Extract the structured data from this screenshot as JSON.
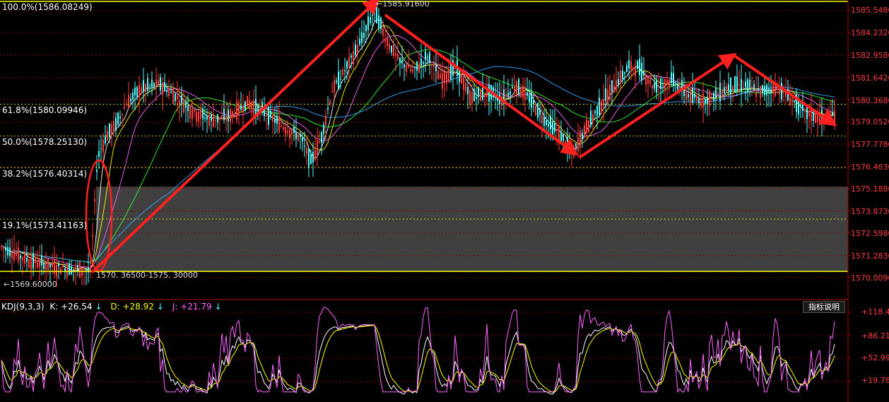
{
  "colors": {
    "background": "#000000",
    "up_candle": "#ff3b3b",
    "down_candle": "#54ffff",
    "axis": "#b00000",
    "fib_line": "#ffff00",
    "annotation": "#ff2020",
    "zone_fill": "#555555",
    "k_line": "#ffffff",
    "d_line": "#ffff00",
    "j_line": "#ff66ff"
  },
  "chart_data": [
    {
      "type": "candlestick",
      "title": "",
      "y_axis_ticks": [
        "1585.5480",
        "1584.2320",
        "1582.9580",
        "1581.6420",
        "1580.3680",
        "1579.0520",
        "1577.7780",
        "1576.4630",
        "1575.1880",
        "1573.8730",
        "1572.5980",
        "1571.2830",
        "1570.0090"
      ],
      "ylim": [
        1569.5,
        1586.4
      ],
      "fibonacci_levels": [
        {
          "label": "100.0%(1586.08249)",
          "value": 1586.08249
        },
        {
          "label": "61.8%(1580.09946)",
          "value": 1580.09946
        },
        {
          "label": "50.0%(1578.25130)",
          "value": 1578.2513
        },
        {
          "label": "38.2%(1576.40314)",
          "value": 1576.40314
        },
        {
          "label": "19.1%(1573.41163)",
          "value": 1573.41163
        }
      ],
      "zero_level": 1570.365,
      "annotations": {
        "high": {
          "label": "1585.91600",
          "value": 1585.916
        },
        "low": {
          "label": "1569.60000",
          "value": 1569.6
        },
        "range": {
          "label": "1570. 36500-1575. 30000",
          "from": 1570.365,
          "to": 1575.3
        }
      },
      "highlight_zone": [
        1570.365,
        1575.3
      ],
      "trend_arrows": [
        {
          "from": [
            130,
            1570.3
          ],
          "to": [
            532,
            1586.1
          ]
        },
        {
          "from": [
            545,
            1585.3
          ],
          "to": [
            812,
            1577.3
          ]
        },
        {
          "from": [
            820,
            1577.0
          ],
          "to": [
            1036,
            1582.9
          ]
        },
        {
          "from": [
            1040,
            1582.9
          ],
          "to": [
            1178,
            1579.0
          ]
        }
      ],
      "price_path": [
        [
          2,
          1571.8
        ],
        [
          40,
          1571.0
        ],
        [
          80,
          1570.6
        ],
        [
          128,
          1570.4
        ],
        [
          138,
          1577.0
        ],
        [
          150,
          1578.2
        ],
        [
          165,
          1579.0
        ],
        [
          180,
          1580.2
        ],
        [
          200,
          1581.0
        ],
        [
          225,
          1581.3
        ],
        [
          250,
          1580.5
        ],
        [
          275,
          1579.6
        ],
        [
          300,
          1579.2
        ],
        [
          325,
          1579.4
        ],
        [
          350,
          1580.2
        ],
        [
          375,
          1579.6
        ],
        [
          400,
          1578.8
        ],
        [
          425,
          1578.2
        ],
        [
          440,
          1576.7
        ],
        [
          455,
          1578.2
        ],
        [
          470,
          1580.9
        ],
        [
          490,
          1582.2
        ],
        [
          510,
          1583.7
        ],
        [
          530,
          1585.6
        ],
        [
          545,
          1584.0
        ],
        [
          565,
          1582.6
        ],
        [
          585,
          1582.0
        ],
        [
          605,
          1582.9
        ],
        [
          625,
          1581.5
        ],
        [
          645,
          1582.3
        ],
        [
          665,
          1580.5
        ],
        [
          690,
          1580.8
        ],
        [
          710,
          1580.4
        ],
        [
          730,
          1581.2
        ],
        [
          750,
          1580.4
        ],
        [
          770,
          1579.2
        ],
        [
          790,
          1578.5
        ],
        [
          810,
          1577.2
        ],
        [
          830,
          1578.8
        ],
        [
          850,
          1580.1
        ],
        [
          870,
          1581.2
        ],
        [
          890,
          1582.3
        ],
        [
          905,
          1582.2
        ],
        [
          925,
          1581.1
        ],
        [
          950,
          1581.5
        ],
        [
          975,
          1580.6
        ],
        [
          995,
          1580.3
        ],
        [
          1015,
          1580.7
        ],
        [
          1035,
          1581.2
        ],
        [
          1055,
          1581.2
        ],
        [
          1075,
          1580.8
        ],
        [
          1100,
          1581.1
        ],
        [
          1120,
          1580.4
        ],
        [
          1140,
          1579.6
        ],
        [
          1160,
          1579.3
        ],
        [
          1180,
          1579.5
        ]
      ]
    },
    {
      "type": "line",
      "title": "KDJ(9,3,3)",
      "series": [
        {
          "name": "K",
          "value": 26.54
        },
        {
          "name": "D",
          "value": 28.92
        },
        {
          "name": "J",
          "value": 21.79
        }
      ],
      "y_axis_ticks": [
        "+118.4",
        "+86.21",
        "+52.99",
        "+19.76"
      ],
      "ylim": [
        5,
        125
      ]
    }
  ],
  "kdj": {
    "title": "KDJ(9,3,3)",
    "k_text": "K: +26.54",
    "d_text": "D: +28.92",
    "j_text": "J: +21.79",
    "down_arrow": "↓",
    "button_label": "指标说明"
  }
}
